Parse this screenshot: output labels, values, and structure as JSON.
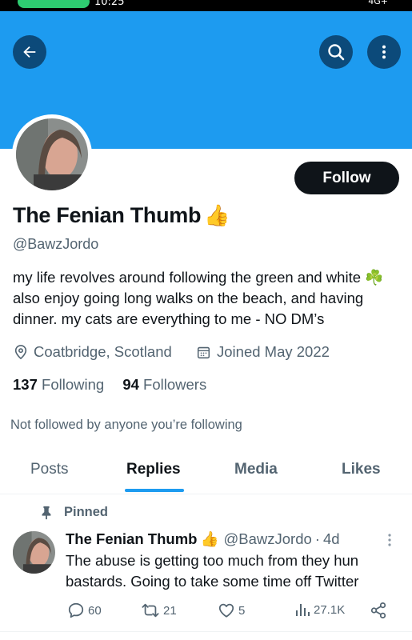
{
  "statusbar": {
    "time": "10:25",
    "network": "4G+"
  },
  "header": {
    "back_icon": "arrow-left-icon",
    "search_icon": "search-icon",
    "more_icon": "more-vertical-icon",
    "banner_color": "#1d9bf0"
  },
  "profile": {
    "display_name": "The Fenian Thumb",
    "name_emoji": "👍",
    "handle": "@BawzJordo",
    "follow_label": "Follow",
    "bio_line1": "my life revolves around following the green and white ",
    "bio_emoji": "☘️",
    "bio_line2": " also enjoy going long walks on the beach, and having dinner. my cats are everything to me - NO DM’s",
    "location": "Coatbridge, Scotland",
    "joined": "Joined May 2022",
    "following_count": "137",
    "following_label": "Following",
    "followers_count": "94",
    "followers_label": "Followers",
    "not_followed_text": "Not followed by anyone you’re following"
  },
  "tabs": [
    {
      "label": "Posts",
      "active": false
    },
    {
      "label": "Replies",
      "active": true
    },
    {
      "label": "Media",
      "active": false
    },
    {
      "label": "Likes",
      "active": false
    }
  ],
  "pinned_post": {
    "pinned_label": "Pinned",
    "author_name": "The Fenian Thumb",
    "author_emoji": "👍",
    "author_handle": "@BawzJordo",
    "separator": "·",
    "time": "4d",
    "text": "The abuse is getting too much from they hun bastards. Going to take some time off Twitter",
    "replies": "60",
    "reposts": "21",
    "likes": "5",
    "views": "27.1K"
  },
  "colors": {
    "accent": "#1d9bf0",
    "text": "#0f1419",
    "muted": "#536471"
  }
}
